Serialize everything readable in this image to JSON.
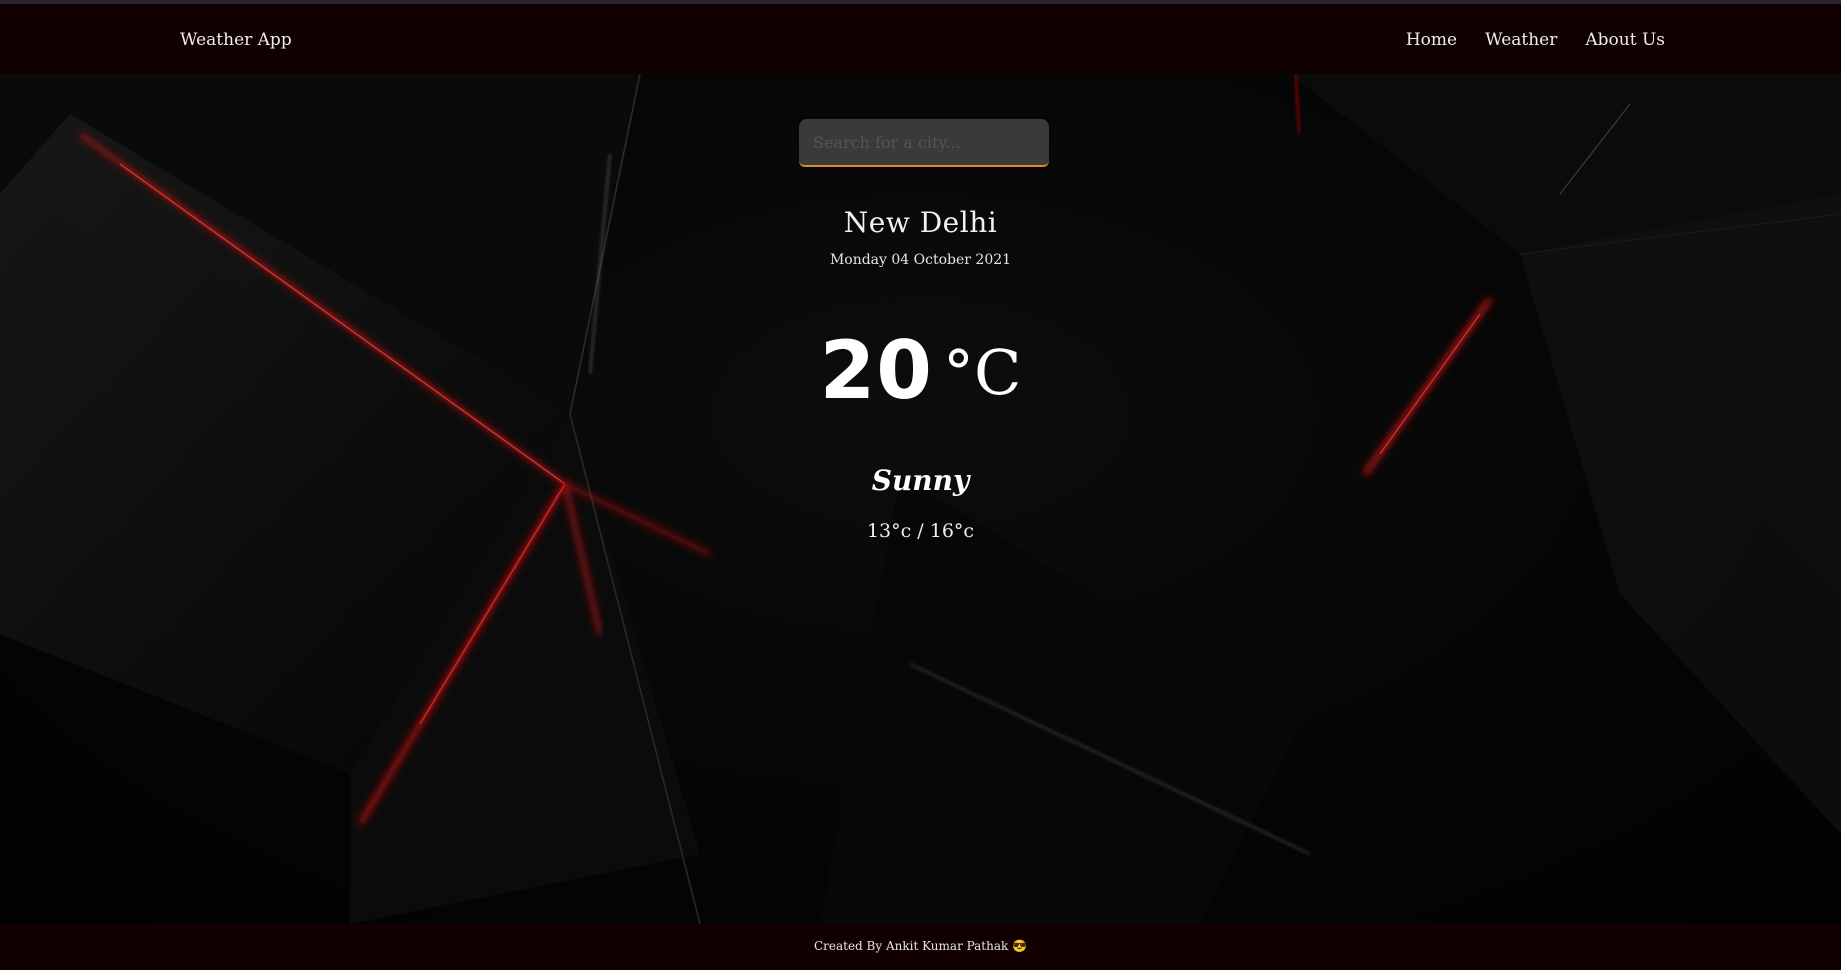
{
  "navbar": {
    "brand": "Weather App",
    "links": [
      "Home",
      "Weather",
      "About Us"
    ]
  },
  "search": {
    "placeholder": "Search for a city...",
    "value": ""
  },
  "weather": {
    "city": "New Delhi",
    "date": "Monday 04 October 2021",
    "temperature": "20",
    "unit": "°C",
    "condition": "Sunny",
    "range": "13°c / 16°c"
  },
  "footer": {
    "credit": "Created By Ankit Kumar Pathak 😎"
  },
  "colors": {
    "bar_bg": "#100002",
    "search_bg": "#3a3a3a",
    "search_accent": "#e08a1e",
    "accent_red": "#c01010"
  }
}
